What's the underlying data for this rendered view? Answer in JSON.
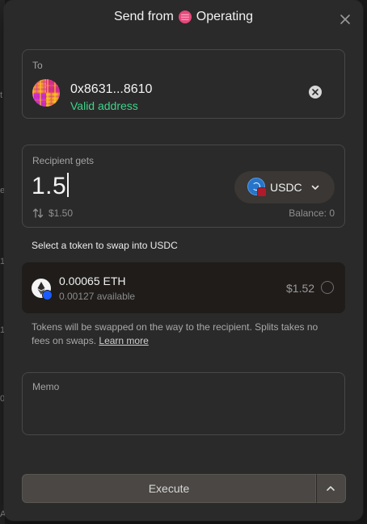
{
  "background_glyphs": [
    "t",
    "e",
    "1",
    "1",
    "0",
    "A"
  ],
  "modal": {
    "title_prefix": "Send from",
    "account_name": "Operating",
    "icons": {
      "account": "safe-icon",
      "close": "close-icon"
    }
  },
  "to": {
    "label": "To",
    "address": "0x8631...8610",
    "status": "Valid address",
    "status_color": "#3fd38a",
    "icons": {
      "avatar": "address-avatar",
      "clear": "clear-icon"
    }
  },
  "recipient": {
    "label": "Recipient gets",
    "amount": "1.5",
    "token": "USDC",
    "usd_value": "$1.50",
    "balance": "Balance: 0",
    "icons": {
      "token": "usdc-icon",
      "chevron": "chevron-down-icon",
      "swap": "swap-arrows-icon"
    }
  },
  "swap": {
    "title": "Select a token to swap into USDC",
    "options": [
      {
        "amount": "0.00065 ETH",
        "available": "0.00127 available",
        "usd": "$1.52",
        "selected": false
      }
    ],
    "note": "Tokens will be swapped on the way to the recipient. Splits takes no fees on swaps.",
    "learn_more": "Learn more"
  },
  "memo": {
    "label": "Memo",
    "value": ""
  },
  "actions": {
    "execute": "Execute",
    "icons": {
      "more": "chevron-up-icon"
    }
  },
  "colors": {
    "accent_green": "#3fd38a",
    "usdc_blue": "#2775ca",
    "brand_pink": "#e5487b"
  }
}
